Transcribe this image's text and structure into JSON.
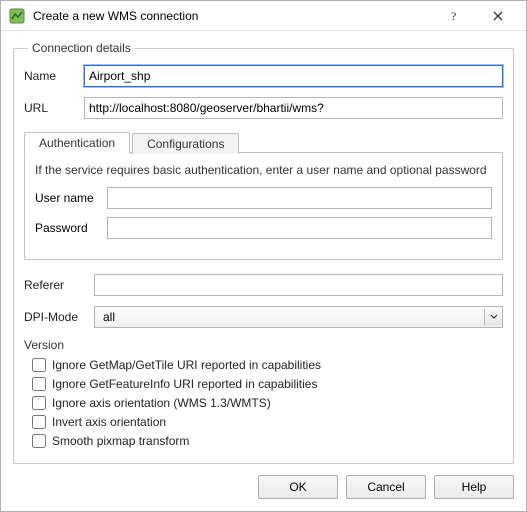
{
  "window": {
    "title": "Create a new WMS connection"
  },
  "group": {
    "legend": "Connection details",
    "name_label": "Name",
    "name_value": "Airport_shp",
    "url_label": "URL",
    "url_value": "http://localhost:8080/geoserver/bhartii/wms?"
  },
  "tabs": {
    "auth": "Authentication",
    "config": "Configurations"
  },
  "auth": {
    "help": "If the service requires basic authentication, enter a user name and optional password",
    "user_label": "User name",
    "user_value": "",
    "pass_label": "Password",
    "pass_value": ""
  },
  "extra": {
    "referer_label": "Referer",
    "referer_value": "",
    "dpi_label": "DPI-Mode",
    "dpi_value": "all",
    "version_label": "Version",
    "cb_getmap": "Ignore GetMap/GetTile URI reported in capabilities",
    "cb_getfeature": "Ignore GetFeatureInfo URI reported in capabilities",
    "cb_axis_ignore": "Ignore axis orientation (WMS 1.3/WMTS)",
    "cb_axis_invert": "Invert axis orientation",
    "cb_smooth": "Smooth pixmap transform"
  },
  "buttons": {
    "ok": "OK",
    "cancel": "Cancel",
    "help": "Help"
  }
}
